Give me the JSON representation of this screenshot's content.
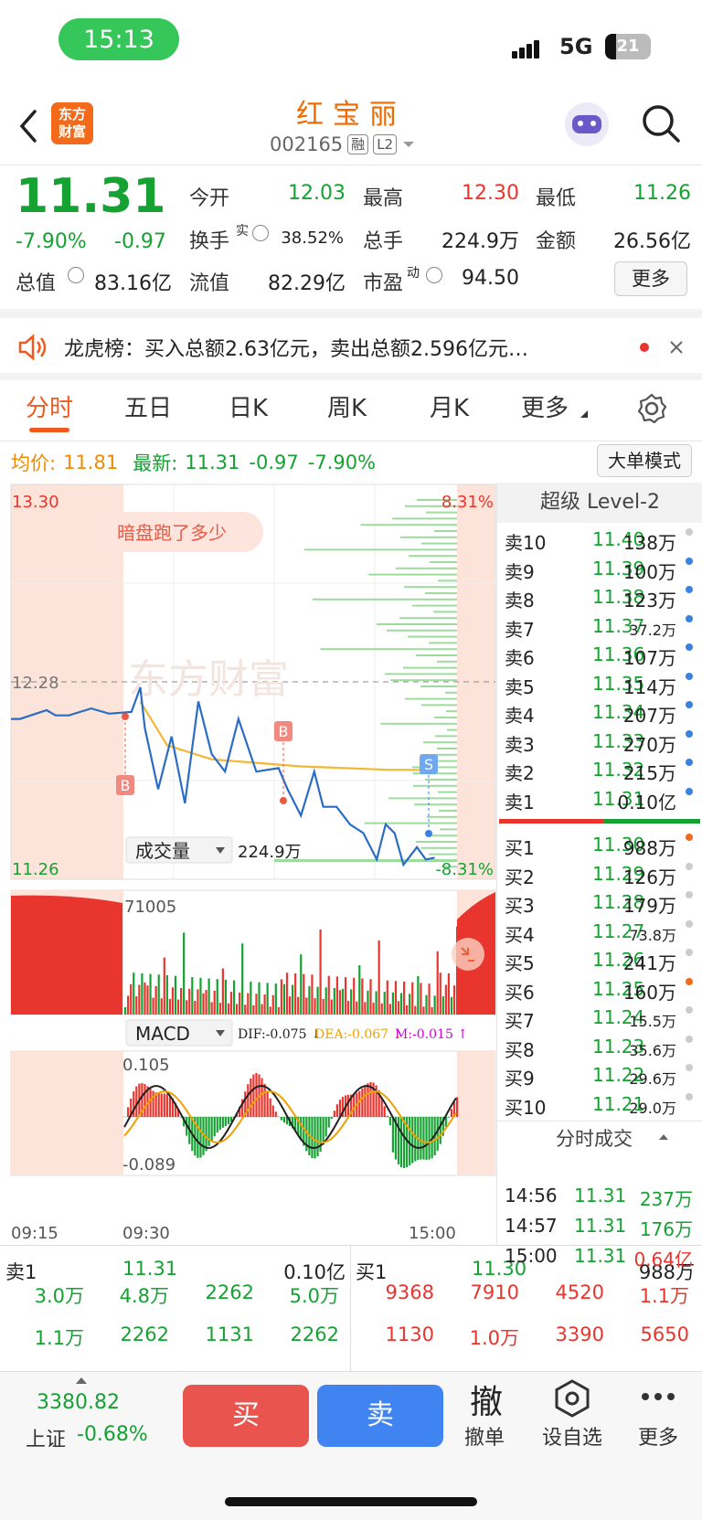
{
  "status": {
    "time": "15:13",
    "network": "5G",
    "battery": "21"
  },
  "header": {
    "name": "红宝丽",
    "code": "002165",
    "tag1": "融",
    "tag2": "L2",
    "logo_line1": "东方",
    "logo_line2": "财富"
  },
  "quote": {
    "price": "11.31",
    "pct": "-7.90%",
    "change": "-0.97",
    "open_label": "今开",
    "open": "12.03",
    "high_label": "最高",
    "high": "12.30",
    "low_label": "最低",
    "low": "11.26",
    "turnover_label": "换手",
    "turnover_sup": "实",
    "turnover": "38.52%",
    "volume_label": "总手",
    "volume": "224.9万",
    "amount_label": "金额",
    "amount": "26.56亿",
    "mcap_label": "总值",
    "mcap": "83.16亿",
    "float_label": "流值",
    "float": "82.29亿",
    "pe_label": "市盈",
    "pe_sup": "动",
    "pe": "94.50",
    "more": "更多"
  },
  "news": {
    "text": "龙虎榜：买入总额2.63亿元，卖出总额2.596亿元…"
  },
  "tabs": [
    "分时",
    "五日",
    "日K",
    "周K",
    "月K",
    "更多"
  ],
  "infobar": {
    "avg_label": "均价:",
    "avg": "11.81",
    "last_label": "最新:",
    "last": "11.31",
    "change": "-0.97",
    "pct": "-7.90%",
    "mode_button": "大单模式"
  },
  "chart_data": [
    {
      "type": "line",
      "title": "",
      "x_ticks": [
        "09:15",
        "09:30",
        "15:00"
      ],
      "y_max": "13.30",
      "y_min": "11.26",
      "pct_max": "8.31%",
      "pct_min": "-8.31%",
      "ref_price": "12.28",
      "watermark": "东方财富",
      "promo": "暗盘跑了多少",
      "markers": [
        "B",
        "B",
        "S"
      ],
      "series": [
        {
          "name": "",
          "points": [
            [
              0,
              12.1
            ],
            [
              0.02,
              12.1
            ],
            [
              0.08,
              12.15
            ],
            [
              0.1,
              12.12
            ],
            [
              0.13,
              12.12
            ],
            [
              0.18,
              12.16
            ],
            [
              0.22,
              12.13
            ],
            [
              0.27,
              12.14
            ],
            [
              0.29,
              12.28
            ],
            [
              0.3,
              12.05
            ],
            [
              0.33,
              11.7
            ],
            [
              0.36,
              12.0
            ],
            [
              0.39,
              11.62
            ],
            [
              0.42,
              12.2
            ],
            [
              0.45,
              11.9
            ],
            [
              0.48,
              11.8
            ],
            [
              0.51,
              12.1
            ],
            [
              0.55,
              11.8
            ],
            [
              0.6,
              11.82
            ],
            [
              0.62,
              11.7
            ],
            [
              0.65,
              11.55
            ],
            [
              0.68,
              11.8
            ],
            [
              0.7,
              11.6
            ],
            [
              0.73,
              11.6
            ],
            [
              0.76,
              11.5
            ],
            [
              0.79,
              11.45
            ],
            [
              0.82,
              11.3
            ],
            [
              0.84,
              11.5
            ],
            [
              0.86,
              11.45
            ],
            [
              0.88,
              11.27
            ],
            [
              0.91,
              11.37
            ],
            [
              0.93,
              11.3
            ],
            [
              0.95,
              11.31
            ]
          ]
        },
        {
          "name": "",
          "points": [
            [
              0.29,
              12.2
            ],
            [
              0.35,
              11.95
            ],
            [
              0.45,
              11.87
            ],
            [
              0.55,
              11.85
            ],
            [
              0.65,
              11.83
            ],
            [
              0.75,
              11.82
            ],
            [
              0.85,
              11.81
            ],
            [
              0.95,
              11.81
            ]
          ]
        }
      ]
    },
    {
      "type": "bar",
      "selector": "成交量",
      "total": "224.9万",
      "max_label": "71005"
    },
    {
      "type": "bar",
      "selector": "MACD",
      "dif": "DIF:-0.075 ↓",
      "dea": "DEA:-0.067 ↓",
      "m": "M:-0.015 ↑",
      "max_label": "0.105",
      "min_label": "-0.089"
    }
  ],
  "orderbook": {
    "title": "超级 Level-2",
    "asks": [
      {
        "label": "卖10",
        "price": "11.40",
        "vol": "138万"
      },
      {
        "label": "卖9",
        "price": "11.39",
        "vol": "100万"
      },
      {
        "label": "卖8",
        "price": "11.38",
        "vol": "123万"
      },
      {
        "label": "卖7",
        "price": "11.37",
        "vol": "37.2万"
      },
      {
        "label": "卖6",
        "price": "11.36",
        "vol": "107万"
      },
      {
        "label": "卖5",
        "price": "11.35",
        "vol": "114万"
      },
      {
        "label": "卖4",
        "price": "11.34",
        "vol": "207万"
      },
      {
        "label": "卖3",
        "price": "11.33",
        "vol": "270万"
      },
      {
        "label": "卖2",
        "price": "11.32",
        "vol": "215万"
      },
      {
        "label": "卖1",
        "price": "11.31",
        "vol": "0.10亿"
      }
    ],
    "bids": [
      {
        "label": "买1",
        "price": "11.30",
        "vol": "988万"
      },
      {
        "label": "买2",
        "price": "11.29",
        "vol": "126万"
      },
      {
        "label": "买3",
        "price": "11.28",
        "vol": "179万"
      },
      {
        "label": "买4",
        "price": "11.27",
        "vol": "73.8万"
      },
      {
        "label": "买5",
        "price": "11.26",
        "vol": "241万"
      },
      {
        "label": "买6",
        "price": "11.25",
        "vol": "160万"
      },
      {
        "label": "买7",
        "price": "11.24",
        "vol": "15.5万"
      },
      {
        "label": "买8",
        "price": "11.23",
        "vol": "35.6万"
      },
      {
        "label": "买9",
        "price": "11.22",
        "vol": "29.6万"
      },
      {
        "label": "买10",
        "price": "11.21",
        "vol": "29.0万"
      }
    ],
    "ticks_title": "分时成交",
    "ticks": [
      {
        "time": "14:56",
        "price": "11.31",
        "vol": "237万"
      },
      {
        "time": "14:57",
        "price": "11.31",
        "vol": "176万"
      },
      {
        "time": "15:00",
        "price": "11.31",
        "vol": "0.64亿"
      }
    ]
  },
  "bottom": {
    "ask_label": "卖1",
    "ask_price": "11.31",
    "ask_vol": "0.10亿",
    "bid_label": "买1",
    "bid_price": "11.30",
    "bid_vol": "988万",
    "ask_q1": [
      "3.0万",
      "4.8万",
      "2262",
      "5.0万"
    ],
    "ask_q2": [
      "1.1万",
      "2262",
      "1131",
      "2262"
    ],
    "bid_q1": [
      "9368",
      "7910",
      "4520",
      "1.1万"
    ],
    "bid_q2": [
      "1130",
      "1.0万",
      "3390",
      "5650"
    ]
  },
  "toolbar": {
    "index_value": "3380.82",
    "index_name": "上证",
    "index_pct": "-0.68%",
    "buy": "买",
    "sell": "卖",
    "cancel_icon": "撤",
    "cancel": "撤单",
    "watchlist": "设自选",
    "more": "更多"
  }
}
